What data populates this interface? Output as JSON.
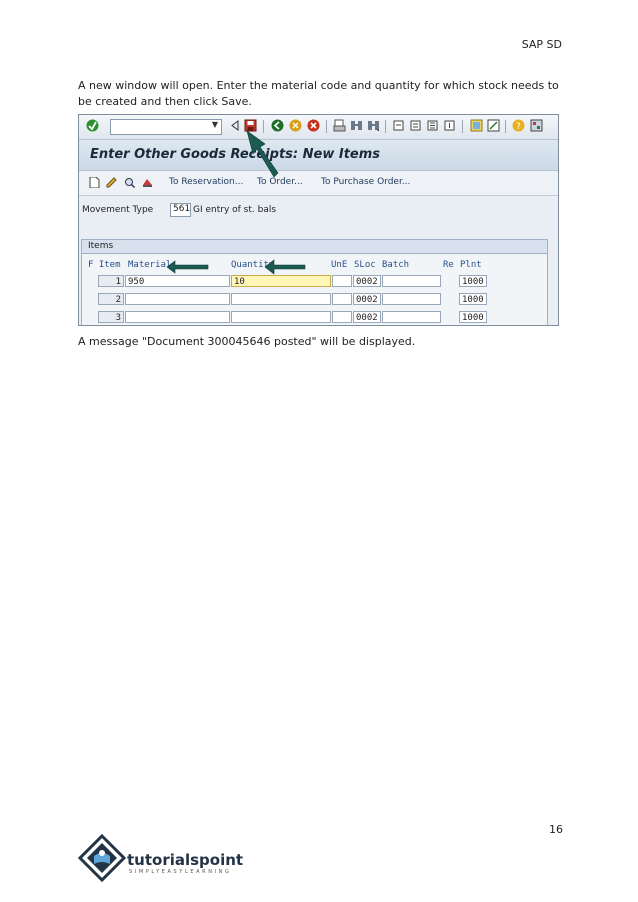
{
  "header": {
    "title": "SAP SD"
  },
  "intro_text": "A new window will open. Enter the material code and quantity for which stock needs to be created and then click Save.",
  "closing_text": "A message \"Document 300045646 posted\" will be displayed.",
  "page_number": "16",
  "sap": {
    "window_title": "Enter Other Goods Receipts: New Items",
    "app_links": [
      "To Reservation...",
      "To Order...",
      "To Purchase Order..."
    ],
    "movement_type_label": "Movement Type",
    "movement_type_code": "561",
    "movement_type_desc": "GI entry of st. bals",
    "items_section": "Items",
    "columns": {
      "f_item": "F Item",
      "material": "Material",
      "quantity": "Quantity",
      "une": "UnE",
      "sloc": "SLoc",
      "batch": "Batch",
      "re": "Re",
      "plnt": "Plnt"
    },
    "rows": [
      {
        "item": "1",
        "material": "950",
        "quantity": "10",
        "sloc": "0002",
        "plnt": "1000"
      },
      {
        "item": "2",
        "material": "",
        "quantity": "",
        "sloc": "0002",
        "plnt": "1000"
      },
      {
        "item": "3",
        "material": "",
        "quantity": "",
        "sloc": "0002",
        "plnt": "1000"
      }
    ]
  },
  "logo": {
    "name": "tutorialspoint",
    "tagline": "SIMPLYEASYLEARNING"
  },
  "colors": {
    "arrow": "#1c5a52",
    "highlight": "#fff6b8",
    "title_bar": "#cbd8e6"
  }
}
